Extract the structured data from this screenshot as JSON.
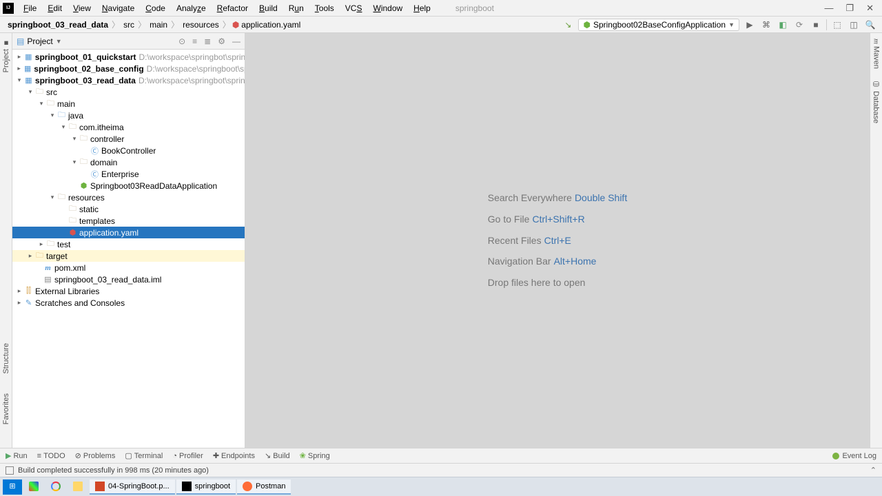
{
  "menu": {
    "items": [
      "File",
      "Edit",
      "View",
      "Navigate",
      "Code",
      "Analyze",
      "Refactor",
      "Build",
      "Run",
      "Tools",
      "VCS",
      "Window",
      "Help"
    ],
    "project_label": "springboot"
  },
  "winctrl": {
    "min": "—",
    "max": "❐",
    "close": "✕"
  },
  "breadcrumb": {
    "root": "springboot_03_read_data",
    "parts": [
      "src",
      "main",
      "resources",
      "application.yaml"
    ]
  },
  "runconfig": {
    "name": "Springboot02BaseConfigApplication"
  },
  "project_header": {
    "title": "Project"
  },
  "tree": {
    "r0": {
      "label": "springboot_01_quickstart",
      "path": "D:\\workspace\\springbot\\sprin"
    },
    "r1": {
      "label": "springboot_02_base_config",
      "path": "D:\\workspace\\springboot\\spr"
    },
    "r2": {
      "label": "springboot_03_read_data",
      "path": "D:\\workspace\\springbot\\sprin"
    },
    "r3": {
      "label": "src"
    },
    "r4": {
      "label": "main"
    },
    "r5": {
      "label": "java"
    },
    "r6": {
      "label": "com.itheima"
    },
    "r7": {
      "label": "controller"
    },
    "r8": {
      "label": "BookController"
    },
    "r9": {
      "label": "domain"
    },
    "r10": {
      "label": "Enterprise"
    },
    "r11": {
      "label": "Springboot03ReadDataApplication"
    },
    "r12": {
      "label": "resources"
    },
    "r13": {
      "label": "static"
    },
    "r14": {
      "label": "templates"
    },
    "r15": {
      "label": "application.yaml"
    },
    "r16": {
      "label": "test"
    },
    "r17": {
      "label": "target"
    },
    "r18": {
      "label": "pom.xml"
    },
    "r19": {
      "label": "springboot_03_read_data.iml"
    },
    "r20": {
      "label": "External Libraries"
    },
    "r21": {
      "label": "Scratches and Consoles"
    }
  },
  "hints": {
    "h0": {
      "t": "Search Everywhere",
      "s": "Double Shift"
    },
    "h1": {
      "t": "Go to File",
      "s": "Ctrl+Shift+R"
    },
    "h2": {
      "t": "Recent Files",
      "s": "Ctrl+E"
    },
    "h3": {
      "t": "Navigation Bar",
      "s": "Alt+Home"
    },
    "h4": {
      "t": "Drop files here to open"
    }
  },
  "bottom": {
    "run": "Run",
    "todo": "TODO",
    "problems": "Problems",
    "terminal": "Terminal",
    "profiler": "Profiler",
    "endpoints": "Endpoints",
    "build": "Build",
    "spring": "Spring",
    "eventlog": "Event Log"
  },
  "status": {
    "msg": "Build completed successfully in 998 ms (20 minutes ago)"
  },
  "left_tabs": {
    "project": "Project"
  },
  "left_tabs2": {
    "structure": "Structure",
    "favorites": "Favorites"
  },
  "right_tabs": {
    "maven": "Maven",
    "database": "Database"
  },
  "taskbar": {
    "ppt": "04-SpringBoot.p...",
    "idea": "springboot",
    "postman": "Postman"
  }
}
